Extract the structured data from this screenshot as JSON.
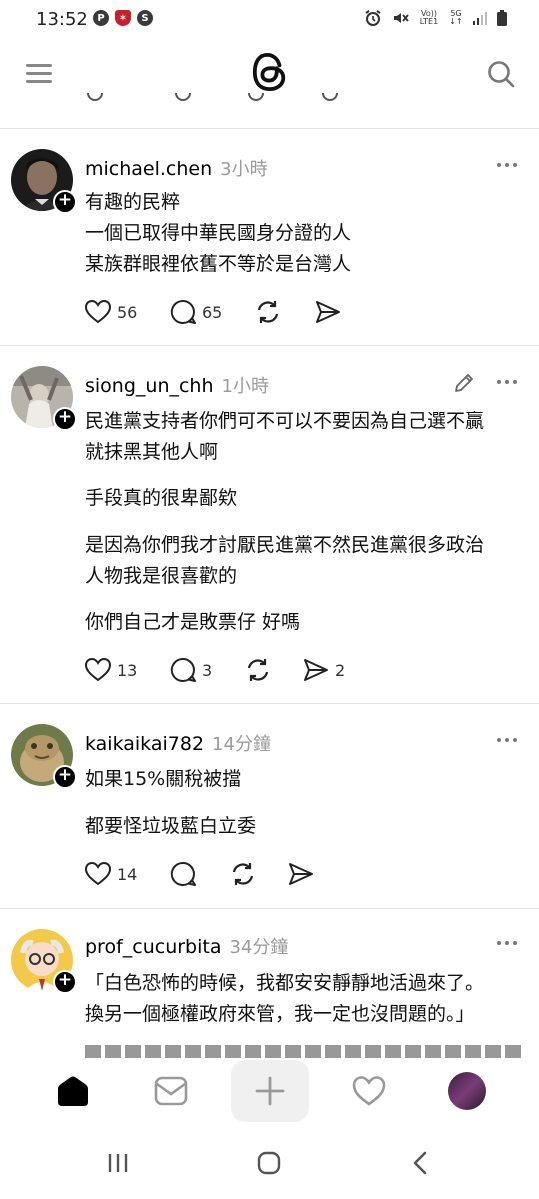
{
  "status_bar": {
    "time": "13:52",
    "left_icons": [
      "parking-app-icon",
      "shield-app-icon",
      "shazam-app-icon"
    ],
    "right_icons": [
      "alarm-icon",
      "mute-icon",
      "volte-icon",
      "5g-icon",
      "signal-icon",
      "battery-icon"
    ],
    "volte_label": "Vo)) LTE1",
    "net_label": "5G"
  },
  "header": {
    "menu_icon": "menu-icon",
    "logo": "threads-logo",
    "search_icon": "search-icon"
  },
  "posts": [
    {
      "username": "michael.chen",
      "time": "3小時",
      "text": "有趣的民粹\n一個已取得中華民國身分證的人\n某族群眼裡依舊不等於是台灣人",
      "likes": "56",
      "replies": "65",
      "reposts": "",
      "shares": ""
    },
    {
      "username": "siong_un_chh",
      "time": "1小時",
      "text": "民進黨支持者你們可不可以不要因為自己選不贏\n就抹黑其他人啊",
      "text2": "手段真的很卑鄙欸",
      "text3": "是因為你們我才討厭民進黨不然民進黨很多政治\n人物我是很喜歡的",
      "text4": "你們自己才是敗票仔 好嗎",
      "likes": "13",
      "replies": "3",
      "reposts": "",
      "shares": "2"
    },
    {
      "username": "kaikaikai782",
      "time": "14分鐘",
      "text": "如果15%關稅被擋",
      "text2": "都要怪垃圾藍白立委",
      "likes": "14",
      "replies": "",
      "reposts": "",
      "shares": ""
    },
    {
      "username": "prof_cucurbita",
      "time": "34分鐘",
      "text": "「白色恐怖的時候，我都安安靜靜地活過來了。\n換另一個極權政府來管，我一定也沒問題的。」"
    }
  ],
  "bottom_nav": [
    "home-icon",
    "inbox-icon",
    "compose-icon",
    "activity-icon",
    "profile-avatar"
  ],
  "system_nav": [
    "recents-icon",
    "home-circle-icon",
    "back-icon"
  ]
}
